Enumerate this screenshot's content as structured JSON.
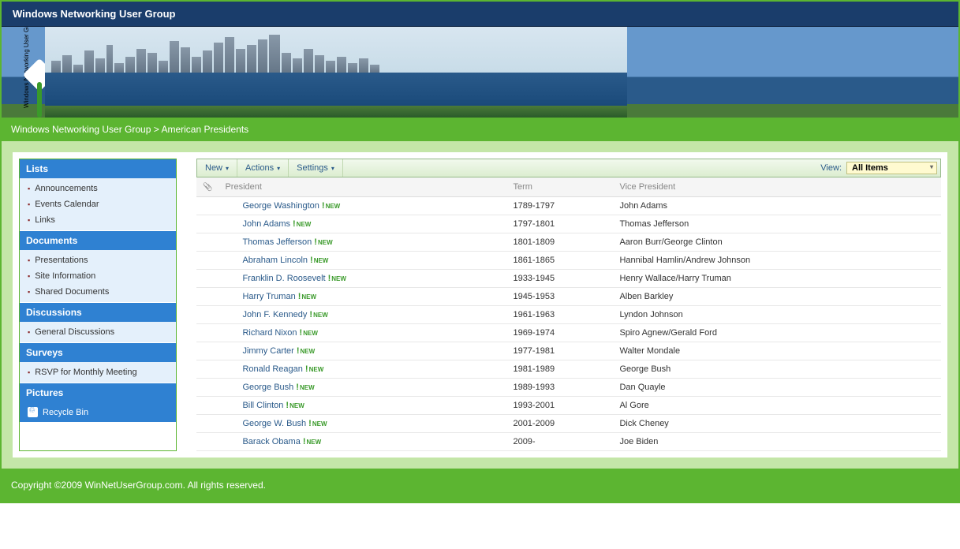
{
  "site_title": "Windows Networking User Group",
  "logo_text": "Windows Networking User Group",
  "breadcrumb": {
    "root": "Windows Networking User Group",
    "sep": ">",
    "current": "American Presidents"
  },
  "sidebar": {
    "sections": [
      {
        "title": "Lists",
        "items": [
          "Announcements",
          "Events Calendar",
          "Links"
        ]
      },
      {
        "title": "Documents",
        "items": [
          "Presentations",
          "Site Information",
          "Shared Documents"
        ]
      },
      {
        "title": "Discussions",
        "items": [
          "General Discussions"
        ]
      },
      {
        "title": "Surveys",
        "items": [
          "RSVP for Monthly Meeting"
        ]
      },
      {
        "title": "Pictures",
        "items": []
      }
    ],
    "recycle": "Recycle Bin"
  },
  "toolbar": {
    "new": "New",
    "actions": "Actions",
    "settings": "Settings",
    "view_label": "View:",
    "view_value": "All Items"
  },
  "columns": {
    "president": "President",
    "term": "Term",
    "vp": "Vice President"
  },
  "new_badge": "NEW",
  "rows": [
    {
      "president": "George Washington",
      "term": "1789-1797",
      "vp": "John Adams",
      "isnew": true
    },
    {
      "president": "John Adams",
      "term": "1797-1801",
      "vp": "Thomas Jefferson",
      "isnew": true
    },
    {
      "president": "Thomas Jefferson",
      "term": "1801-1809",
      "vp": "Aaron Burr/George Clinton",
      "isnew": true
    },
    {
      "president": "Abraham Lincoln",
      "term": "1861-1865",
      "vp": "Hannibal Hamlin/Andrew Johnson",
      "isnew": true
    },
    {
      "president": "Franklin D. Roosevelt",
      "term": "1933-1945",
      "vp": "Henry Wallace/Harry Truman",
      "isnew": true
    },
    {
      "president": "Harry Truman",
      "term": "1945-1953",
      "vp": "Alben Barkley",
      "isnew": true
    },
    {
      "president": "John F. Kennedy",
      "term": "1961-1963",
      "vp": "Lyndon Johnson",
      "isnew": true
    },
    {
      "president": "Richard Nixon",
      "term": "1969-1974",
      "vp": "Spiro Agnew/Gerald Ford",
      "isnew": true
    },
    {
      "president": "Jimmy Carter",
      "term": "1977-1981",
      "vp": "Walter Mondale",
      "isnew": true
    },
    {
      "president": "Ronald Reagan",
      "term": "1981-1989",
      "vp": "George Bush",
      "isnew": true
    },
    {
      "president": "George Bush",
      "term": "1989-1993",
      "vp": "Dan Quayle",
      "isnew": true
    },
    {
      "president": "Bill Clinton",
      "term": "1993-2001",
      "vp": "Al Gore",
      "isnew": true
    },
    {
      "president": "George W. Bush",
      "term": "2001-2009",
      "vp": "Dick Cheney",
      "isnew": true
    },
    {
      "president": "Barack Obama",
      "term": "2009-",
      "vp": "Joe Biden",
      "isnew": true
    }
  ],
  "footer": "Copyright ©2009 WinNetUserGroup.com. All rights reserved."
}
